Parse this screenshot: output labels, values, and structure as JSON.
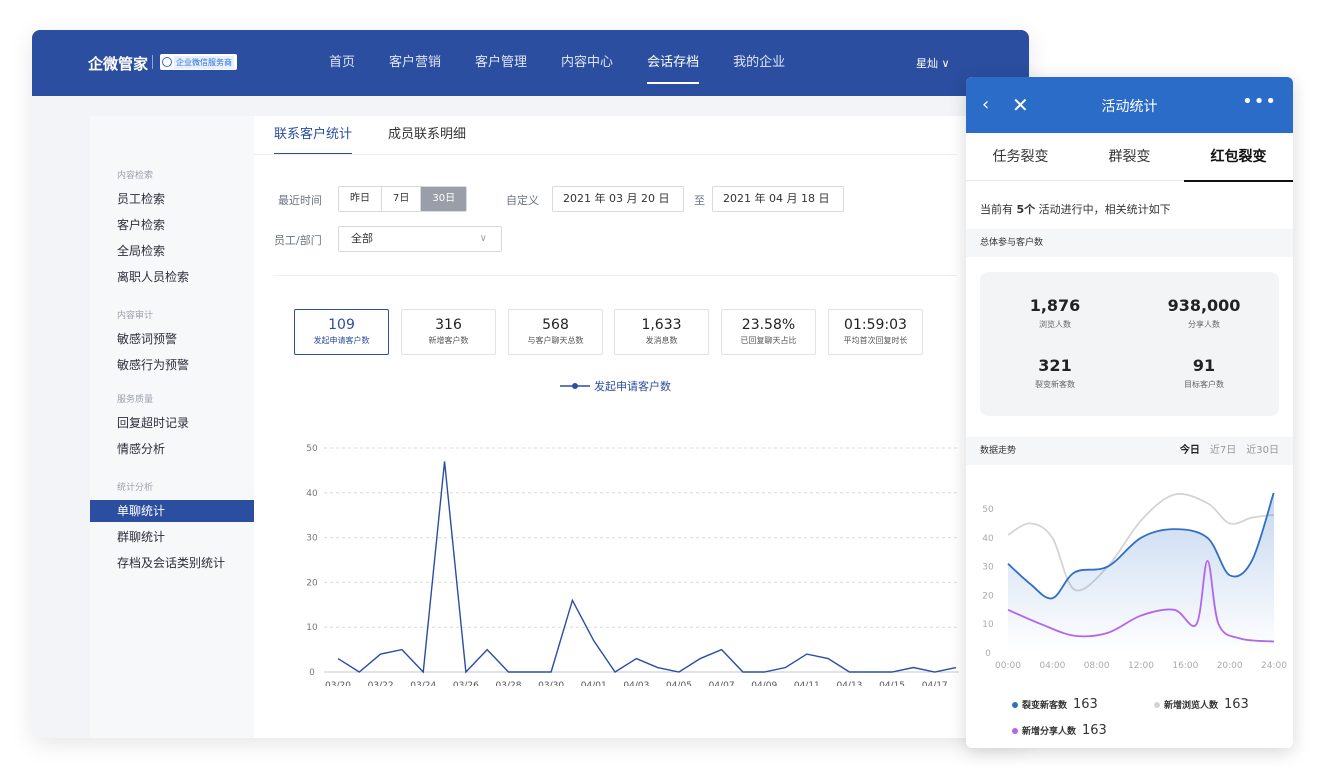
{
  "header": {
    "brand": "企微管家",
    "badge": "企业微信服务商",
    "nav": [
      "首页",
      "客户营销",
      "客户管理",
      "内容中心",
      "会话存档",
      "我的企业"
    ],
    "active_nav": 4,
    "user": "星灿 ∨"
  },
  "sidebar": {
    "groups": [
      {
        "title": "内容检索",
        "items": [
          "员工检索",
          "客户检索",
          "全局检索",
          "离职人员检索"
        ]
      },
      {
        "title": "内容审计",
        "items": [
          "敏感词预警",
          "敏感行为预警"
        ]
      },
      {
        "title": "服务质量",
        "items": [
          "回复超时记录",
          "情感分析"
        ]
      },
      {
        "title": "统计分析",
        "items": [
          "单聊统计",
          "群聊统计",
          "存档及会话类别统计"
        ]
      }
    ],
    "active_item": "单聊统计"
  },
  "main": {
    "tabs": [
      "联系客户统计",
      "成员联系明细"
    ],
    "active_tab": 0,
    "filters": {
      "recent_label": "最近时间",
      "ranges": [
        "昨日",
        "7日",
        "30日"
      ],
      "active_range": 2,
      "custom_label": "自定义",
      "start_date": "2021 年 03 月 20 日",
      "to_label": "至",
      "end_date": "2021 年 04 月 18 日",
      "dept_label": "员工/部门",
      "dept_value": "全部"
    },
    "kpis": [
      {
        "value": "109",
        "label": "发起申请客户数"
      },
      {
        "value": "316",
        "label": "新增客户数"
      },
      {
        "value": "568",
        "label": "与客户聊天总数"
      },
      {
        "value": "1,633",
        "label": "发消息数"
      },
      {
        "value": "23.58%",
        "label": "已回复聊天占比"
      },
      {
        "value": "01:59:03",
        "label": "平均首次回复时长"
      }
    ],
    "active_kpi": 0
  },
  "chart_data": [
    {
      "type": "line",
      "x": [
        "03/20",
        "03/21",
        "03/22",
        "03/23",
        "03/24",
        "03/25",
        "03/26",
        "03/27",
        "03/28",
        "03/29",
        "03/30",
        "03/31",
        "04/01",
        "04/02",
        "04/03",
        "04/04",
        "04/05",
        "04/06",
        "04/07",
        "04/08",
        "04/09",
        "04/10",
        "04/11",
        "04/12",
        "04/13",
        "04/14",
        "04/15",
        "04/16",
        "04/17",
        "04/18"
      ],
      "xticks": [
        "03/20",
        "03/22",
        "03/24",
        "03/26",
        "03/28",
        "03/30",
        "04/01",
        "04/03",
        "04/05",
        "04/07",
        "04/09",
        "04/11",
        "04/13",
        "04/15",
        "04/17"
      ],
      "series": [
        {
          "name": "发起申请客户数",
          "values": [
            3,
            0,
            4,
            5,
            0,
            47,
            0,
            5,
            0,
            0,
            0,
            16,
            7,
            0,
            3,
            1,
            0,
            3,
            5,
            0,
            0,
            1,
            4,
            3,
            0,
            0,
            0,
            1,
            0,
            1
          ]
        }
      ],
      "ylim": [
        0,
        50
      ],
      "yticks": [
        0,
        10,
        20,
        30,
        40,
        50
      ],
      "grid": true,
      "legend": "top-center",
      "color": "#2b4ea0"
    },
    {
      "type": "line",
      "x": [
        "00:00",
        "04:00",
        "08:00",
        "12:00",
        "16:00",
        "20:00",
        "24:00"
      ],
      "xticks": [
        "00:00",
        "04:00",
        "08:00",
        "12:00",
        "16:00",
        "20:00",
        "24:00"
      ],
      "yticks": [
        0,
        10,
        20,
        30,
        40,
        50
      ],
      "ylim": [
        0,
        50
      ],
      "series": [
        {
          "name": "裂变新客数",
          "total": "163",
          "color": "#2f6fc6",
          "points": [
            [
              0,
              31
            ],
            [
              2,
              24
            ],
            [
              4,
              19
            ],
            [
              6,
              28
            ],
            [
              9,
              30
            ],
            [
              12,
              40
            ],
            [
              15,
              43
            ],
            [
              18,
              40
            ],
            [
              20,
              27
            ],
            [
              22,
              32
            ],
            [
              24,
              56
            ]
          ]
        },
        {
          "name": "新增浏览人数",
          "total": "163",
          "color": "#d4d4d4",
          "points": [
            [
              0,
              41
            ],
            [
              2,
              45
            ],
            [
              4,
              40
            ],
            [
              6,
              22
            ],
            [
              9,
              30
            ],
            [
              12,
              46
            ],
            [
              15,
              55
            ],
            [
              18,
              52
            ],
            [
              20,
              45
            ],
            [
              22,
              47
            ],
            [
              24,
              48
            ]
          ]
        },
        {
          "name": "新增分享人数",
          "total": "163",
          "color": "#b266ee",
          "points": [
            [
              0,
              15
            ],
            [
              3,
              10
            ],
            [
              6,
              6
            ],
            [
              9,
              7
            ],
            [
              12,
              13
            ],
            [
              15,
              15
            ],
            [
              17,
              10
            ],
            [
              18,
              32
            ],
            [
              19,
              10
            ],
            [
              21,
              5
            ],
            [
              24,
              4
            ]
          ]
        }
      ],
      "legend": "bottom"
    }
  ],
  "panel": {
    "title": "活动统计",
    "tabs": [
      "任务裂变",
      "群裂变",
      "红包裂变"
    ],
    "active_tab": 2,
    "note_prefix": "当前有 ",
    "note_count": "5个",
    "note_suffix": " 活动进行中，相关统计如下",
    "section_total": "总体参与客户数",
    "stats": [
      {
        "value": "1,876",
        "label": "浏览人数"
      },
      {
        "value": "938,000",
        "label": "分享人数"
      },
      {
        "value": "321",
        "label": "裂变新客数"
      },
      {
        "value": "91",
        "label": "目标客户数"
      }
    ],
    "section_trend": "数据走势",
    "ranges": [
      "今日",
      "近7日",
      "近30日"
    ],
    "active_range": 0
  }
}
